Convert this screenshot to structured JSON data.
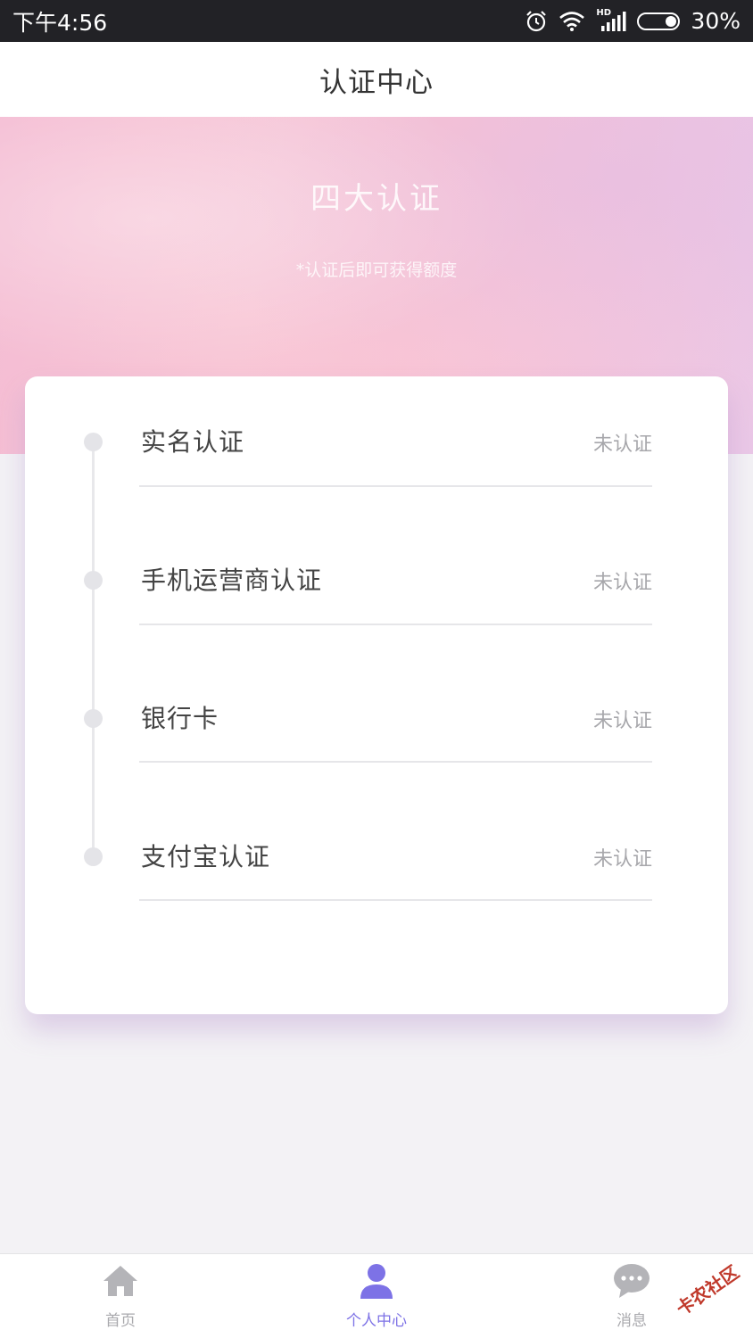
{
  "status_bar": {
    "time": "下午4:56",
    "battery_percent": "30%",
    "battery_level": 0.3,
    "network_label": "HD",
    "icons": [
      "alarm-icon",
      "wifi-icon",
      "signal-icon",
      "battery-icon"
    ]
  },
  "header": {
    "title": "认证中心"
  },
  "banner": {
    "title": "四大认证",
    "subtitle": "*认证后即可获得额度"
  },
  "verification": {
    "items": [
      {
        "label": "实名认证",
        "status": "未认证"
      },
      {
        "label": "手机运营商认证",
        "status": "未认证"
      },
      {
        "label": "银行卡",
        "status": "未认证"
      },
      {
        "label": "支付宝认证",
        "status": "未认证"
      }
    ]
  },
  "bottom_nav": {
    "items": [
      {
        "label": "首页",
        "icon": "home-icon",
        "active": false
      },
      {
        "label": "个人中心",
        "icon": "user-icon",
        "active": true
      },
      {
        "label": "消息",
        "icon": "message-icon",
        "active": false
      }
    ]
  },
  "watermark": {
    "text": "卡农社区"
  },
  "colors": {
    "accent": "#7d72e6",
    "status_bar_bg": "#222226",
    "inactive_nav": "#b4b4b8"
  }
}
